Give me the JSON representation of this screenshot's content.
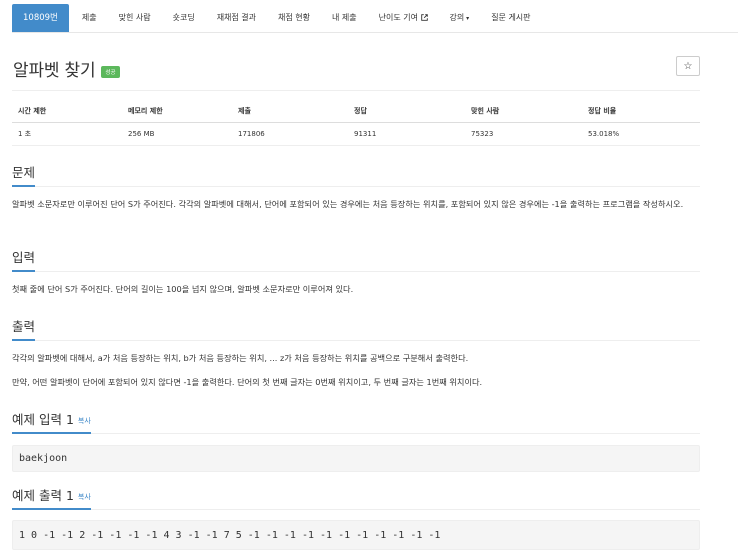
{
  "nav": {
    "problem_id": "10809번",
    "items": [
      "제출",
      "맞힌 사람",
      "숏코딩",
      "재채점 결과",
      "채점 현황",
      "내 제출",
      "난이도 기여",
      "강의",
      "질문 게시판"
    ]
  },
  "problem": {
    "title": "알파벳 찾기",
    "badge": "성공",
    "star": "☆"
  },
  "info_table": {
    "headers": [
      "시간 제한",
      "메모리 제한",
      "제출",
      "정답",
      "맞힌 사람",
      "정답 비율"
    ],
    "values": [
      "1 초",
      "256 MB",
      "171806",
      "91311",
      "75323",
      "53.018%"
    ]
  },
  "sections": {
    "problem": {
      "heading": "문제",
      "text": "알파벳 소문자로만 이루어진 단어 S가 주어진다. 각각의 알파벳에 대해서, 단어에 포함되어 있는 경우에는 처음 등장하는 위치를, 포함되어 있지 않은 경우에는 -1을 출력하는 프로그램을 작성하시오."
    },
    "input": {
      "heading": "입력",
      "text": "첫째 줄에 단어 S가 주어진다. 단어의 길이는 100을 넘지 않으며, 알파벳 소문자로만 이루어져 있다."
    },
    "output": {
      "heading": "출력",
      "text1": "각각의 알파벳에 대해서, a가 처음 등장하는 위치, b가 처음 등장하는 위치, ... z가 처음 등장하는 위치를 공백으로 구분해서 출력한다.",
      "text2": "만약, 어떤 알파벳이 단어에 포함되어 있지 않다면 -1을 출력한다. 단어의 첫 번째 글자는 0번째 위치이고, 두 번째 글자는 1번째 위치이다."
    },
    "sample_input": {
      "heading": "예제 입력 1",
      "copy": "복사",
      "value": "baekjoon"
    },
    "sample_output": {
      "heading": "예제 출력 1",
      "copy": "복사",
      "value": "1 0 -1 -1 2 -1 -1 -1 -1 4 3 -1 -1 7 5 -1 -1 -1 -1 -1 -1 -1 -1 -1 -1 -1"
    }
  }
}
